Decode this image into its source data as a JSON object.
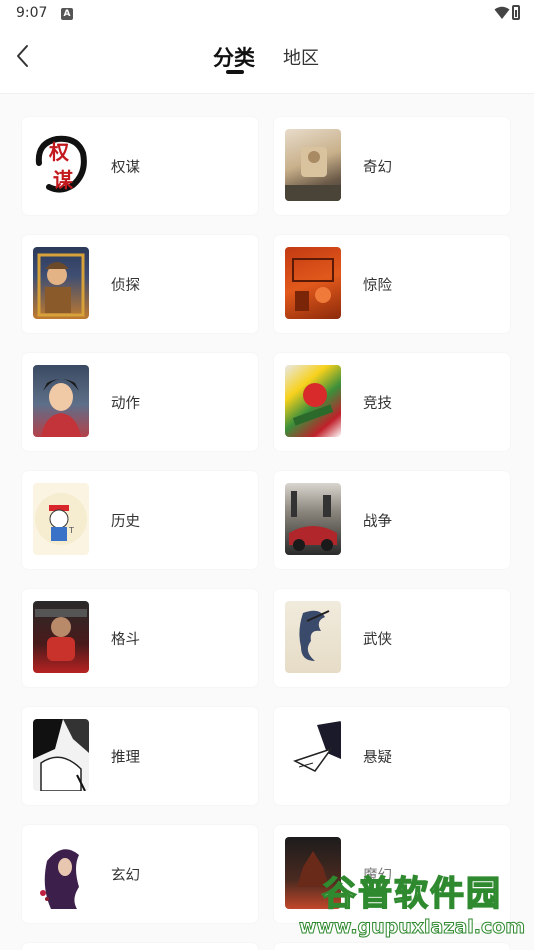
{
  "status_bar": {
    "time": "9:07",
    "notification_icon": "A"
  },
  "header": {
    "tabs": [
      {
        "label": "分类",
        "active": true
      },
      {
        "label": "地区",
        "active": false
      }
    ]
  },
  "categories": [
    {
      "label": "权谋",
      "thumb": "calligraphy"
    },
    {
      "label": "奇幻",
      "thumb": "fantasy"
    },
    {
      "label": "侦探",
      "thumb": "detective"
    },
    {
      "label": "惊险",
      "thumb": "thriller"
    },
    {
      "label": "动作",
      "thumb": "action"
    },
    {
      "label": "竞技",
      "thumb": "sports"
    },
    {
      "label": "历史",
      "thumb": "history"
    },
    {
      "label": "战争",
      "thumb": "war"
    },
    {
      "label": "格斗",
      "thumb": "fighting"
    },
    {
      "label": "武侠",
      "thumb": "wuxia"
    },
    {
      "label": "推理",
      "thumb": "mystery"
    },
    {
      "label": "悬疑",
      "thumb": "suspense"
    },
    {
      "label": "玄幻",
      "thumb": "xuanhuan"
    },
    {
      "label": "魔幻",
      "thumb": "magic"
    }
  ],
  "calligraphy_text": {
    "top": "权",
    "bottom": "谋"
  },
  "watermark": {
    "title": "谷普软件园",
    "url": "www.gupuxlazal.com"
  }
}
